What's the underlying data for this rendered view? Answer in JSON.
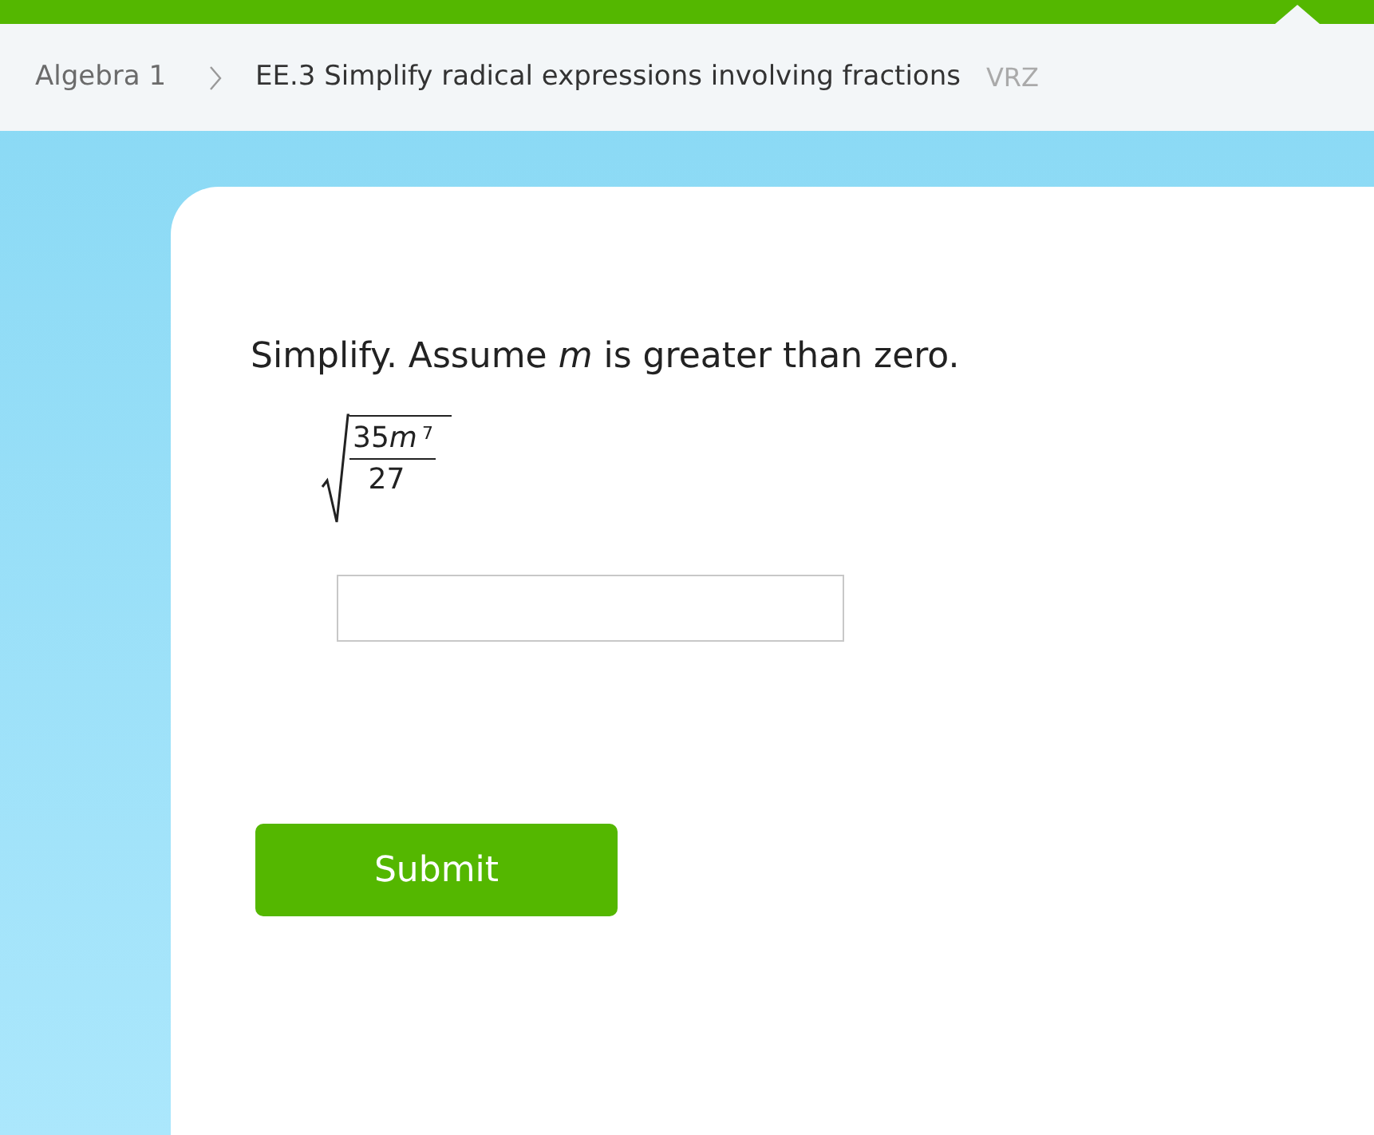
{
  "breadcrumb": {
    "course": "Algebra 1",
    "skill": "EE.3 Simplify radical expressions involving fractions",
    "code": "VRZ"
  },
  "question": {
    "prompt": "Simplify. Assume *m* is greater than zero.",
    "numerator": {
      "coefficient": "35",
      "variable": "m",
      "exponent": "7"
    },
    "denominator": "27"
  },
  "submit": {
    "label": "Submit"
  }
}
